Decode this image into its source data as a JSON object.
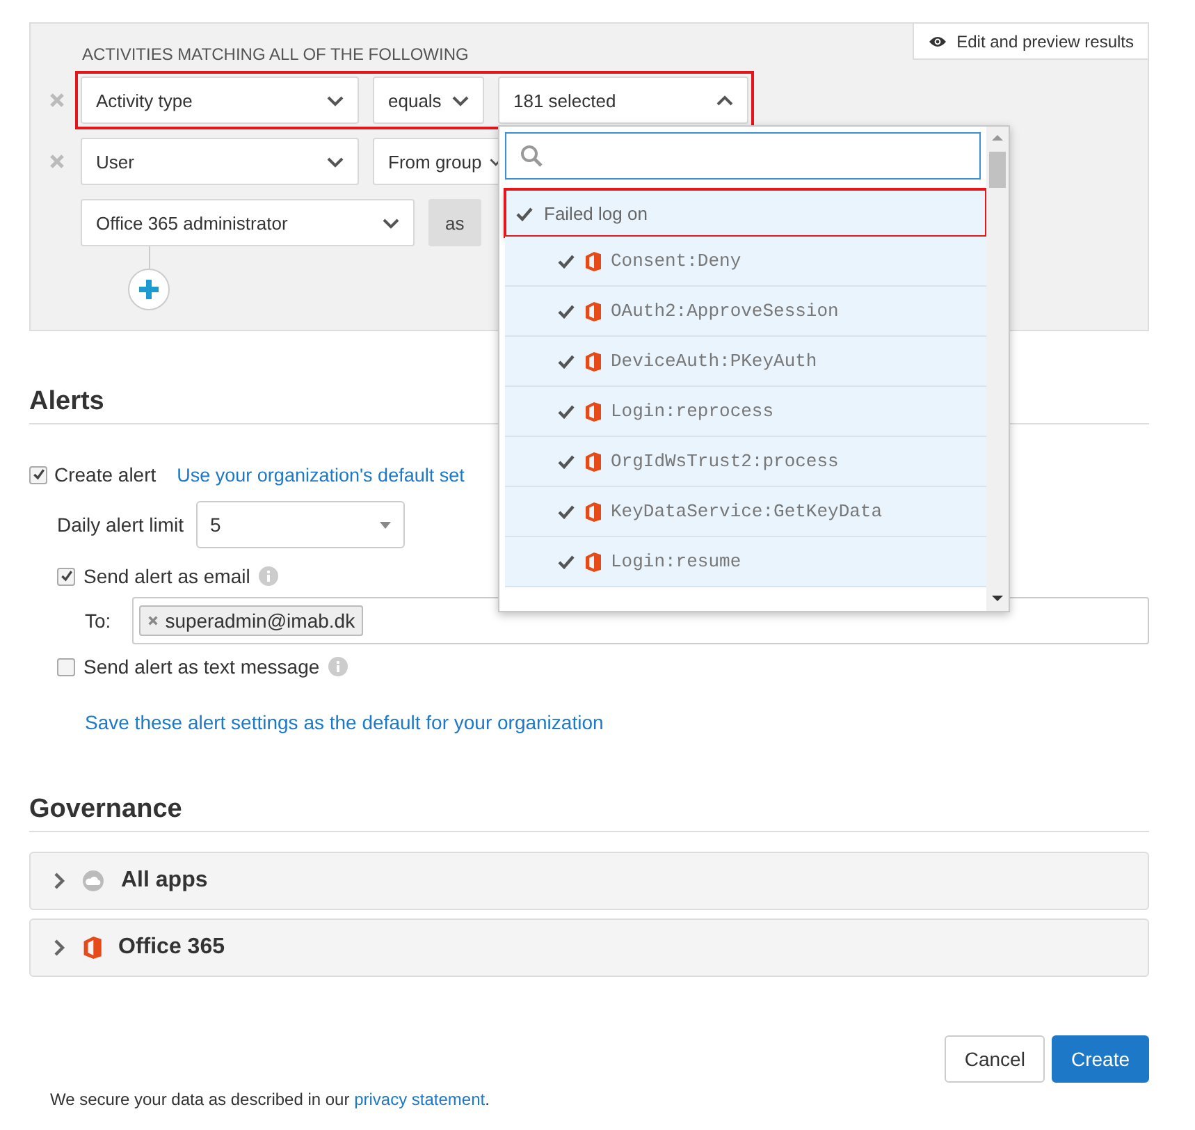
{
  "filter": {
    "edit_button": "Edit and preview results",
    "title": "ACTIVITIES MATCHING ALL OF THE FOLLOWING",
    "rows": [
      {
        "removable": true,
        "highlighted": true,
        "fields": [
          {
            "kind": "select",
            "value": "Activity type",
            "open": false
          },
          {
            "kind": "select",
            "value": "equals",
            "open": false
          },
          {
            "kind": "select",
            "value": "181 selected",
            "open": true
          }
        ]
      },
      {
        "removable": true,
        "highlighted": false,
        "fields": [
          {
            "kind": "select",
            "value": "User",
            "open": false
          },
          {
            "kind": "select",
            "value": "From group",
            "open": false
          }
        ]
      },
      {
        "removable": false,
        "highlighted": false,
        "fields": [
          {
            "kind": "select",
            "value": "Office 365 administrator",
            "open": false
          },
          {
            "kind": "label",
            "value": "as"
          }
        ]
      }
    ]
  },
  "activity_dropdown": {
    "group": {
      "label": "Failed log on",
      "checked": true,
      "highlighted": true
    },
    "items": [
      {
        "label": "Consent:Deny",
        "checked": true
      },
      {
        "label": "OAuth2:ApproveSession",
        "checked": true
      },
      {
        "label": "DeviceAuth:PKeyAuth",
        "checked": true
      },
      {
        "label": "Login:reprocess",
        "checked": true
      },
      {
        "label": "OrgIdWsTrust2:process",
        "checked": true
      },
      {
        "label": "KeyDataService:GetKeyData",
        "checked": true
      },
      {
        "label": "Login:resume",
        "checked": true
      }
    ]
  },
  "alerts": {
    "title": "Alerts",
    "create_alert": {
      "label": "Create alert",
      "checked": true,
      "link": "Use your organization's default set"
    },
    "daily_limit": {
      "label": "Daily alert limit",
      "value": "5"
    },
    "email": {
      "label": "Send alert as email",
      "checked": true,
      "to_label": "To:",
      "recipients": [
        "superadmin@imab.dk"
      ]
    },
    "text_message": {
      "label": "Send alert as text message",
      "checked": false
    },
    "save_link": "Save these alert settings as the default for your organization"
  },
  "governance": {
    "title": "Governance",
    "items": [
      {
        "label": "All apps",
        "kind": "cloud",
        "expanded": false
      },
      {
        "label": "Office 365",
        "kind": "office",
        "expanded": false
      }
    ]
  },
  "buttons": [
    {
      "label": "Cancel",
      "kind": "secondary"
    },
    {
      "label": "Create",
      "kind": "primary"
    }
  ],
  "footer": {
    "text": "We secure your data as described in our ",
    "link": "privacy statement",
    "end": "."
  }
}
